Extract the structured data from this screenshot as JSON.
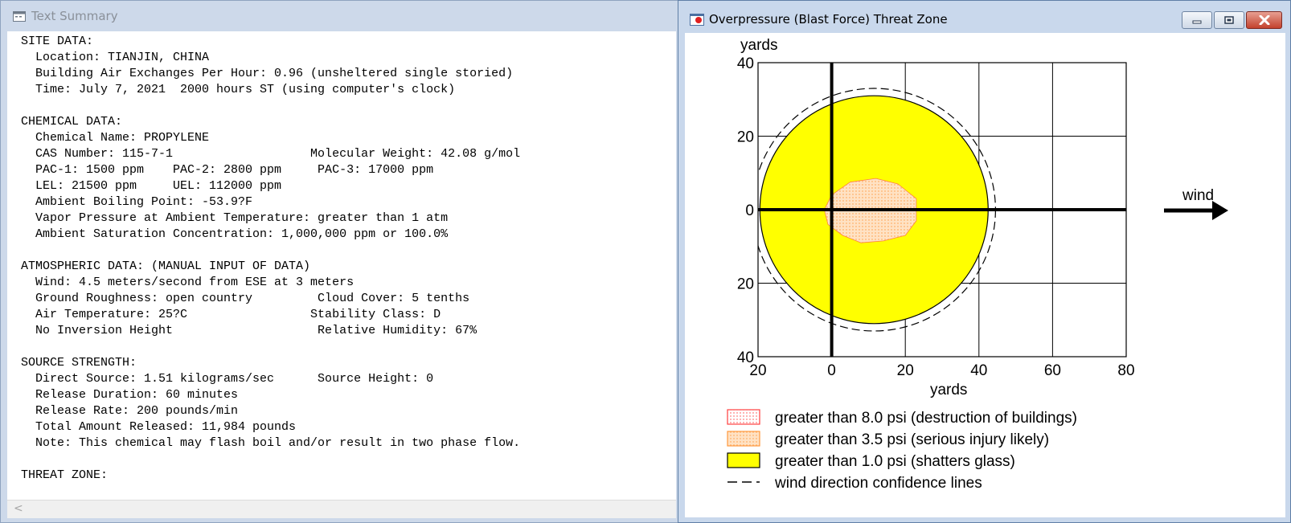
{
  "text_window": {
    "title": "Text Summary",
    "content": "SITE DATA:\n  Location: TIANJIN, CHINA\n  Building Air Exchanges Per Hour: 0.96 (unsheltered single storied)\n  Time: July 7, 2021  2000 hours ST (using computer's clock)\n\nCHEMICAL DATA:\n  Chemical Name: PROPYLENE\n  CAS Number: 115-7-1                   Molecular Weight: 42.08 g/mol\n  PAC-1: 1500 ppm    PAC-2: 2800 ppm     PAC-3: 17000 ppm\n  LEL: 21500 ppm     UEL: 112000 ppm\n  Ambient Boiling Point: -53.9?F\n  Vapor Pressure at Ambient Temperature: greater than 1 atm\n  Ambient Saturation Concentration: 1,000,000 ppm or 100.0%\n\nATMOSPHERIC DATA: (MANUAL INPUT OF DATA)\n  Wind: 4.5 meters/second from ESE at 3 meters\n  Ground Roughness: open country         Cloud Cover: 5 tenths\n  Air Temperature: 25?C                 Stability Class: D\n  No Inversion Height                    Relative Humidity: 67%\n\nSOURCE STRENGTH:\n  Direct Source: 1.51 kilograms/sec      Source Height: 0\n  Release Duration: 60 minutes\n  Release Rate: 200 pounds/min\n  Total Amount Released: 11,984 pounds\n  Note: This chemical may flash boil and/or result in two phase flow.\n\nTHREAT ZONE:",
    "scroll_left_glyph": "<"
  },
  "threat_window": {
    "title": "Overpressure (Blast Force) Threat Zone",
    "colors": {
      "red_zone": "#ff4040",
      "orange_zone": "#ffd9b3",
      "yellow_zone": "#ffff00",
      "close_button": "#c3412c"
    }
  },
  "chart_data": {
    "type": "area",
    "xlabel": "yards",
    "ylabel": "yards",
    "xlim": [
      -20,
      80
    ],
    "ylim": [
      -40,
      40
    ],
    "x_ticks": [
      -20,
      0,
      20,
      40,
      60,
      80
    ],
    "y_ticks": [
      40,
      20,
      0,
      -20,
      -40
    ],
    "x_tick_labels": [
      "20",
      "0",
      "20",
      "40",
      "60",
      "80"
    ],
    "y_tick_labels": [
      "40",
      "20",
      "0",
      "20",
      "40"
    ],
    "grid": true,
    "wind_label": "wind",
    "zones": [
      {
        "name": "greater than 8.0 psi (destruction of buildings)",
        "points": []
      },
      {
        "name": "greater than 3.5 psi (serious injury likely)",
        "points": [
          [
            -2,
            0
          ],
          [
            0,
            4
          ],
          [
            5,
            7.5
          ],
          [
            12,
            8.5
          ],
          [
            18,
            7
          ],
          [
            23,
            3
          ],
          [
            23,
            -3
          ],
          [
            20,
            -7
          ],
          [
            14,
            -8.5
          ],
          [
            8,
            -9
          ],
          [
            3,
            -7
          ],
          [
            -1,
            -4
          ]
        ]
      },
      {
        "name": "greater than 1.0 psi (shatters glass)",
        "center": [
          11.5,
          0
        ],
        "radius": 31
      }
    ],
    "confidence_lines": {
      "name": "wind direction confidence lines",
      "center": [
        11.5,
        0
      ],
      "radius": 33
    },
    "legend": [
      {
        "label": "greater than 8.0 psi (destruction of buildings)",
        "swatch": "red-dotted"
      },
      {
        "label": "greater than 3.5 psi (serious injury likely)",
        "swatch": "orange-dotted"
      },
      {
        "label": "greater than 1.0 psi (shatters glass)",
        "swatch": "yellow"
      },
      {
        "label": "wind direction confidence lines",
        "swatch": "dashed"
      }
    ]
  }
}
